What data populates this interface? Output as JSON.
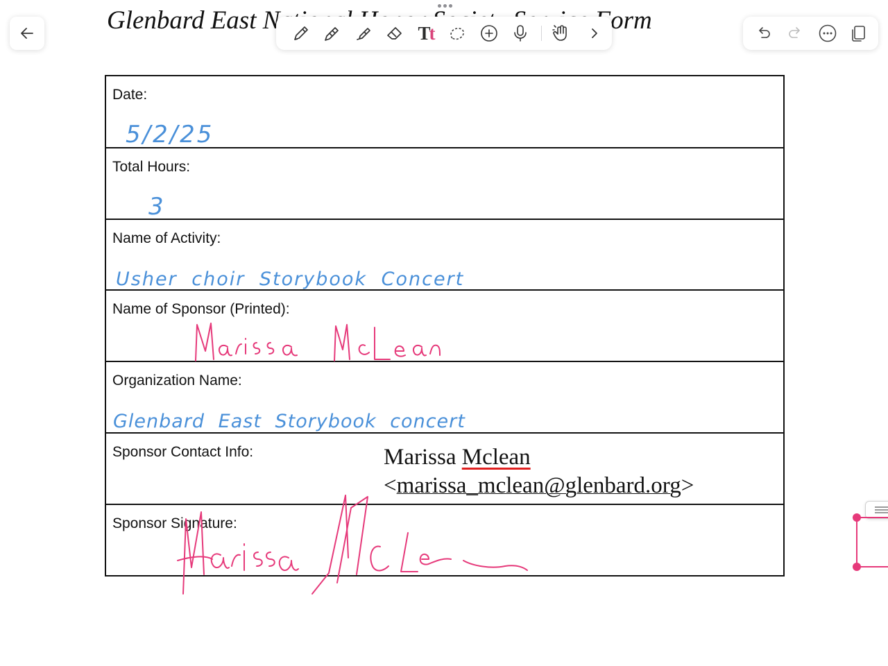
{
  "document": {
    "title": "Glenbard East National Honor Society Service Form"
  },
  "toolbar": {
    "tools": [
      "pen-icon",
      "pencil-icon",
      "highlighter-icon",
      "eraser-icon",
      "text-tool-icon",
      "lasso-icon",
      "add-icon",
      "microphone-icon",
      "touch-hand-icon",
      "chevron-right-icon"
    ],
    "text_tool_label": "Tt"
  },
  "top_right": {
    "buttons": [
      "undo-icon",
      "redo-icon",
      "more-icon",
      "pages-icon"
    ]
  },
  "form": {
    "rows": [
      {
        "label": "Date:",
        "value": "5/2/25"
      },
      {
        "label": "Total Hours:",
        "value": "3"
      },
      {
        "label": "Name of Activity:",
        "value": "Usher choir Storybook Concert"
      },
      {
        "label": "Name of Sponsor (Printed):",
        "value": "Marissa McLean"
      },
      {
        "label": "Organization Name:",
        "value": "Glenbard East Storybook concert"
      },
      {
        "label": "Sponsor Contact Info:",
        "value": ""
      },
      {
        "label": "Sponsor Signature:",
        "value": "Marissa McLean"
      }
    ],
    "contact": {
      "name_first": "Marissa",
      "name_last": "Mclean",
      "email_open": "<",
      "email": "marissa_mclean@glenbard.org",
      "email_close": ">"
    }
  },
  "colors": {
    "ink_blue": "#4a90d9",
    "ink_pink": "#e6397a",
    "accent_text_tool": "#d9437a",
    "border": "#111111"
  }
}
